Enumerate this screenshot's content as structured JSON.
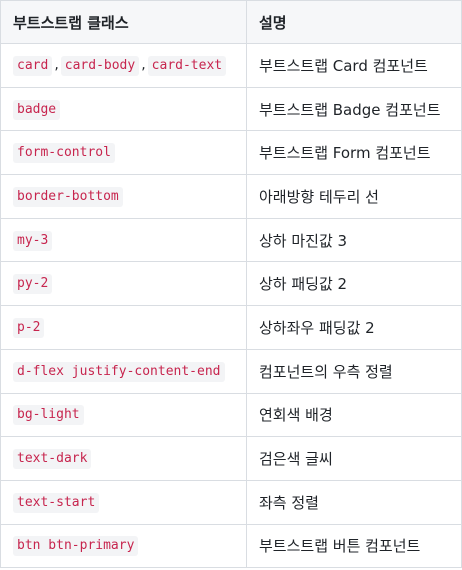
{
  "table": {
    "headers": [
      "부트스트랩 클래스",
      "설명"
    ],
    "rows": [
      {
        "classes": [
          "card",
          "card-body",
          "card-text"
        ],
        "desc": "부트스트랩 Card 컴포넌트"
      },
      {
        "classes": [
          "badge"
        ],
        "desc": "부트스트랩 Badge 컴포넌트"
      },
      {
        "classes": [
          "form-control"
        ],
        "desc": "부트스트랩 Form 컴포넌트"
      },
      {
        "classes": [
          "border-bottom"
        ],
        "desc": "아래방향 테두리 선"
      },
      {
        "classes": [
          "my-3"
        ],
        "desc": "상하 마진값 3"
      },
      {
        "classes": [
          "py-2"
        ],
        "desc": "상하 패딩값 2"
      },
      {
        "classes": [
          "p-2"
        ],
        "desc": "상하좌우 패딩값 2"
      },
      {
        "classes": [
          "d-flex justify-content-end"
        ],
        "desc": "컴포넌트의 우측 정렬"
      },
      {
        "classes": [
          "bg-light"
        ],
        "desc": "연회색 배경"
      },
      {
        "classes": [
          "text-dark"
        ],
        "desc": "검은색 글씨"
      },
      {
        "classes": [
          "text-start"
        ],
        "desc": "좌측 정렬"
      },
      {
        "classes": [
          "btn btn-primary"
        ],
        "desc": "부트스트랩 버튼 컴포넌트"
      }
    ],
    "separator": ",",
    "colors": {
      "code_text": "#c7254e",
      "code_bg": "#f3f4f6",
      "header_bg": "#f6f7f9",
      "border": "#d9dde2"
    }
  }
}
